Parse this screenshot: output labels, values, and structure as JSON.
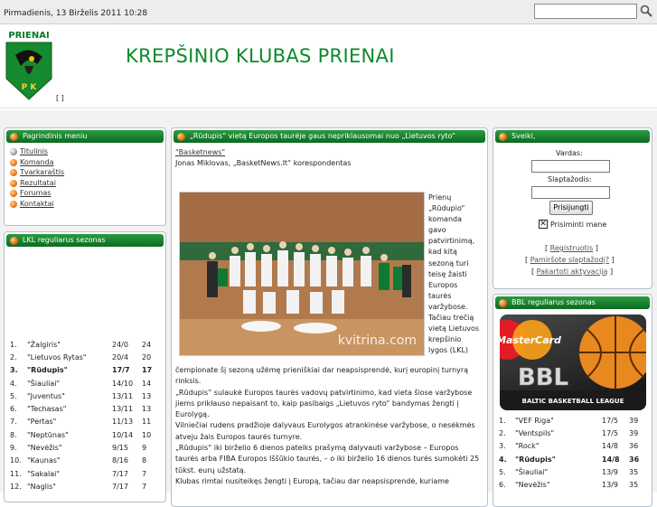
{
  "topbar": {
    "date": "Pirmadienis, 13 Birželis 2011 10:28",
    "search_value": ""
  },
  "header": {
    "title": "KREPŠINIO KLUBAS PRIENAI",
    "logo_text": "PRIENAI",
    "logo_letters": "P  K",
    "brackets": "[ ]"
  },
  "main_menu": {
    "title": "Pagrindinis meniu",
    "items": [
      {
        "label": "Titulinis"
      },
      {
        "label": "Komanda"
      },
      {
        "label": "Tvarkaraštis"
      },
      {
        "label": "Rezultatai"
      },
      {
        "label": "Forumas"
      },
      {
        "label": "Kontaktai"
      }
    ]
  },
  "lkl": {
    "title": "LKL reguliarus sezonas",
    "rows": [
      [
        "1.",
        "\"Žalgiris\"",
        "24/0",
        "24"
      ],
      [
        "2.",
        "\"Lietuvos Rytas\"",
        "20/4",
        "20"
      ],
      [
        "3.",
        "\"Rūdupis\"",
        "17/7",
        "17"
      ],
      [
        "4.",
        "\"Šiauliai\"",
        "14/10",
        "14"
      ],
      [
        "5.",
        "\"Juventus\"",
        "13/11",
        "13"
      ],
      [
        "6.",
        "\"Techasas\"",
        "13/11",
        "13"
      ],
      [
        "7.",
        "\"Pertas\"",
        "11/13",
        "11"
      ],
      [
        "8.",
        "\"Neptūnas\"",
        "10/14",
        "10"
      ],
      [
        "9.",
        "\"Nevėžis\"",
        "9/15",
        "9"
      ],
      [
        "10.",
        "\"Kaunas\"",
        "8/16",
        "8"
      ],
      [
        "11.",
        "\"Sakalai\"",
        "7/17",
        "7"
      ],
      [
        "12.",
        "\"Naglis\"",
        "7/17",
        "7"
      ]
    ]
  },
  "article": {
    "title": "„Rūdupis“ vietą Europos taurėje gaus nepriklausomai nuo „Lietuvos ryto“",
    "source": "\"Basketnews\"",
    "author": "Jonas Miklovas, „BasketNews.lt“ korespondentas",
    "photo_watermark": "kvitrina.com",
    "wrap_text": "Prienų „Rūdupio“ komanda gavo patvirtinimą, kad kitą sezoną turi teisę žaisti Europos taurės varžybose. Tačiau trečią vietą Lietuvos krepšinio lygos (LKL)",
    "paragraphs": [
      "čempionate šį sezoną užėmę prieniškiai dar neapsisprendė, kurį europinį turnyrą rinksis.",
      "„Rūdupis“ sulaukė Europos taurės vadovų patvirtinimo, kad vieta šiose varžybose jiems prikłauso nepaisant to, kaip pasibaigs „Lietuvos ryto“ bandymas žengti į Eurolygą.",
      "Vilniečiai rudens pradžioje dalyvaus Eurolygos atrankinėse varžybose, o nesėkmės atveju žais Europos taurės turnyre.",
      "„Rūdupis“ iki birželio 6 dienos pateiks prašymą dalyvauti varžybose – Europos taurės arba FIBA Europos Iššūkio taurės, – o iki birželio 16 dienos turės sumokėti 25 tūkst. eurų užstatą.",
      "Klubas rimtai nusiteikęs žengti į Europą, tačiau dar neapsisprendė, kuriame"
    ]
  },
  "login": {
    "title": "Sveiki,",
    "user_label": "Vardas:",
    "pass_label": "Slaptažodis:",
    "button": "Prisijungti",
    "remember": "Prisiminti mane",
    "links": [
      {
        "pre": "[ ",
        "text": "Registruotis",
        "post": " ]"
      },
      {
        "pre": "[ ",
        "text": "Pamiršote slaptažodį?",
        "post": " ]"
      },
      {
        "pre": "[ ",
        "text": "Pakartoti aktyvaciją",
        "post": " ]"
      }
    ]
  },
  "bbl": {
    "title": "BBL reguliarus sezonas",
    "banner": {
      "brand": "MasterCard",
      "name": "BBL",
      "subtitle": "BALTIC BASKETBALL LEAGUE"
    },
    "rows": [
      [
        "1.",
        "\"VEF Riga\"",
        "17/5",
        "39"
      ],
      [
        "2.",
        "\"Ventspils\"",
        "17/5",
        "39"
      ],
      [
        "3.",
        "\"Rock\"",
        "14/8",
        "36"
      ],
      [
        "4.",
        "\"Rūdupis\"",
        "14/8",
        "36"
      ],
      [
        "5.",
        "\"Šiauliai\"",
        "13/9",
        "35"
      ],
      [
        "6.",
        "\"Nevėžis\"",
        "13/9",
        "35"
      ]
    ]
  },
  "colors": {
    "accent_green": "#0c8a2a",
    "caption_green": "#1b7f30",
    "bullet_orange": "#ea7a18"
  }
}
